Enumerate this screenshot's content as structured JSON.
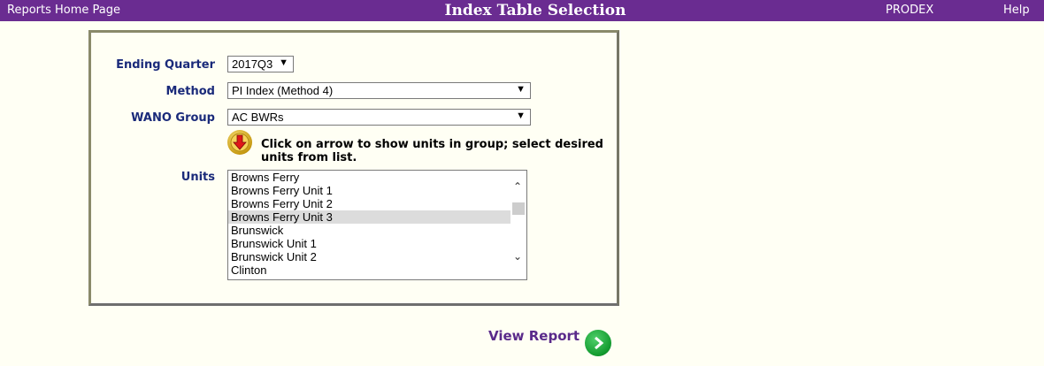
{
  "header": {
    "home_link": "Reports Home Page",
    "title": "Index Table Selection",
    "prodex_link": "PRODEX",
    "help_link": "Help"
  },
  "form": {
    "quarter_label": "Ending Quarter",
    "quarter_value": "2017Q3",
    "method_label": "Method",
    "method_value": "PI Index (Method 4)",
    "group_label": "WANO Group",
    "group_value": "AC BWRs",
    "instruction": "Click on arrow to show units in group; select desired units from list.",
    "units_label": "Units",
    "units": [
      "Browns Ferry",
      "Browns Ferry Unit 1",
      "Browns Ferry Unit 2",
      "Browns Ferry Unit 3",
      "Brunswick",
      "Brunswick Unit 1",
      "Brunswick Unit 2",
      "Clinton"
    ],
    "selected_unit": "Browns Ferry Unit 3"
  },
  "footer": {
    "view_report": "View Report"
  },
  "colors": {
    "header_bg": "#6a2c91",
    "label_color": "#1a2a7a",
    "view_report_color": "#5a2a8a"
  }
}
